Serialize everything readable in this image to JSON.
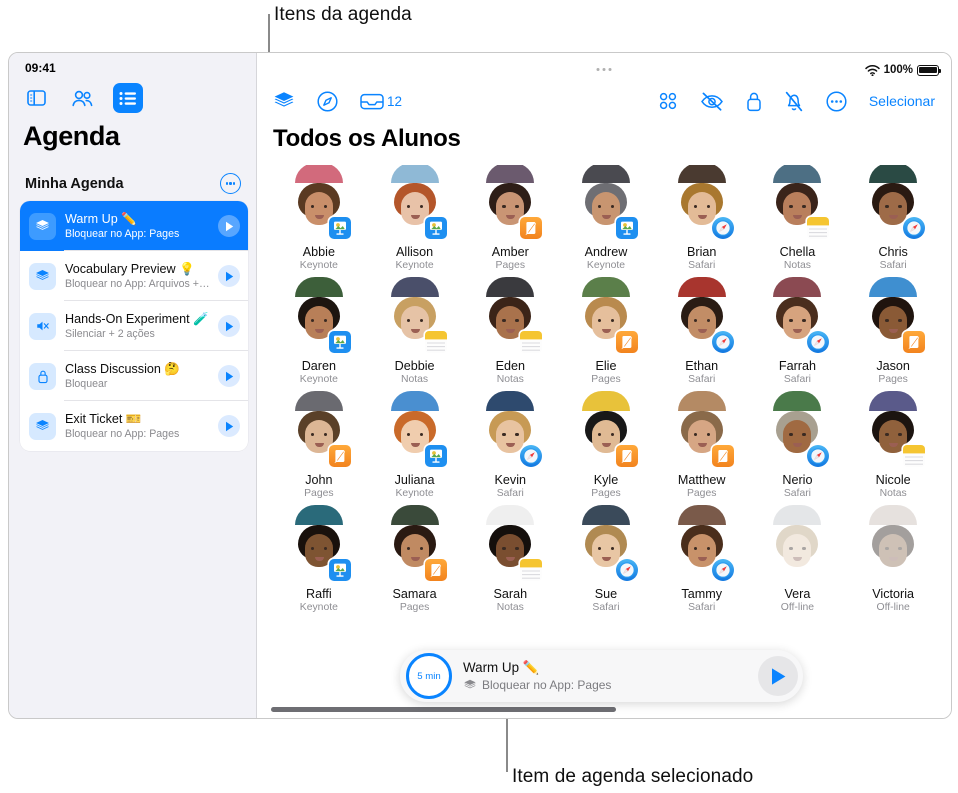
{
  "callouts": {
    "top": "Itens da agenda",
    "bottom": "Item de agenda selecionado"
  },
  "status_bar": {
    "time": "09:41",
    "battery_percent": "100%",
    "wifi_icon": "wifi-icon",
    "battery_icon": "battery-icon"
  },
  "sidebar": {
    "nav_icons": [
      {
        "name": "sidebar-toggle-icon",
        "active": false
      },
      {
        "name": "people-icon",
        "active": false
      },
      {
        "name": "list-icon",
        "active": true
      }
    ],
    "title": "Agenda",
    "section_label": "Minha Agenda",
    "more_button": "more-ellipsis-button",
    "items": [
      {
        "title": "Warm Up ✏️",
        "subtitle": "Bloquear no App: Pages",
        "icon": "layers-icon",
        "selected": true
      },
      {
        "title": "Vocabulary Preview 💡",
        "subtitle": "Bloquear no App: Arquivos +…",
        "icon": "layers-icon",
        "selected": false
      },
      {
        "title": "Hands-On Experiment 🧪",
        "subtitle": "Silenciar + 2 ações",
        "icon": "mute-icon",
        "selected": false
      },
      {
        "title": "Class Discussion 🤔",
        "subtitle": "Bloquear",
        "icon": "lock-icon",
        "selected": false
      },
      {
        "title": "Exit Ticket 🎫",
        "subtitle": "Bloquear no App: Pages",
        "icon": "layers-icon",
        "selected": false
      }
    ]
  },
  "toolbar": {
    "left": [
      {
        "name": "layers-icon",
        "label": ""
      },
      {
        "name": "compass-icon",
        "label": ""
      },
      {
        "name": "inbox-icon",
        "label": "12"
      }
    ],
    "right": [
      {
        "name": "grid-view-icon",
        "label": ""
      },
      {
        "name": "eye-slash-icon",
        "label": ""
      },
      {
        "name": "lock-icon",
        "label": ""
      },
      {
        "name": "bell-slash-icon",
        "label": ""
      },
      {
        "name": "more-ellipsis-icon",
        "label": ""
      }
    ],
    "select_label": "Selecionar"
  },
  "main": {
    "title": "Todos os Alunos",
    "students": [
      {
        "name": "Abbie",
        "app": "Keynote",
        "badge": "keynote",
        "offline": false,
        "hair": "#5a3a22",
        "skin": "#c98f6a",
        "body": "#d26a7c",
        "bg": "#a8bfa0"
      },
      {
        "name": "Allison",
        "app": "Keynote",
        "badge": "keynote",
        "offline": false,
        "hair": "#b4562a",
        "skin": "#e8c2a8",
        "body": "#8fb9d6",
        "bg": "#b6cbd8"
      },
      {
        "name": "Amber",
        "app": "Pages",
        "badge": "pages",
        "offline": false,
        "hair": "#2e1e17",
        "skin": "#c99574",
        "body": "#6b5a6e",
        "bg": "#6f7f8c"
      },
      {
        "name": "Andrew",
        "app": "Keynote",
        "badge": "keynote",
        "offline": false,
        "hair": "#6e6e73",
        "skin": "#c89570",
        "body": "#4a4a50",
        "bg": "#8d8d93"
      },
      {
        "name": "Brian",
        "app": "Safari",
        "badge": "safari",
        "offline": false,
        "hair": "#a9782f",
        "skin": "#e3bb97",
        "body": "#4a3a30",
        "bg": "#2f2721"
      },
      {
        "name": "Chella",
        "app": "Notas",
        "badge": "notas",
        "offline": false,
        "hair": "#3a241a",
        "skin": "#b97f5c",
        "body": "#4d6f84",
        "bg": "#b9c4b4"
      },
      {
        "name": "Chris",
        "app": "Safari",
        "badge": "safari",
        "offline": false,
        "hair": "#2a1a12",
        "skin": "#9e6b48",
        "body": "#2a4a44",
        "bg": "#2b5e56"
      },
      {
        "name": "Daren",
        "app": "Keynote",
        "badge": "keynote",
        "offline": false,
        "hair": "#1d1510",
        "skin": "#b87f58",
        "body": "#3d5f3a",
        "bg": "#8fa67f"
      },
      {
        "name": "Debbie",
        "app": "Notas",
        "badge": "notas",
        "offline": false,
        "hair": "#c8a062",
        "skin": "#e6c3a6",
        "body": "#4a4f6a",
        "bg": "#565b74"
      },
      {
        "name": "Eden",
        "app": "Notas",
        "badge": "notas",
        "offline": false,
        "hair": "#3b2418",
        "skin": "#a9724c",
        "body": "#3a3a3e",
        "bg": "#d8d2c8"
      },
      {
        "name": "Elie",
        "app": "Pages",
        "badge": "pages",
        "offline": false,
        "hair": "#b98a4e",
        "skin": "#e5bf9c",
        "body": "#5b7f4a",
        "bg": "#7a9b5e"
      },
      {
        "name": "Ethan",
        "app": "Safari",
        "badge": "safari",
        "offline": false,
        "hair": "#2a1c14",
        "skin": "#c28d66",
        "body": "#a8352e",
        "bg": "#3c4a3a"
      },
      {
        "name": "Farrah",
        "app": "Safari",
        "badge": "safari",
        "offline": false,
        "hair": "#4a2e1e",
        "skin": "#d6a37e",
        "body": "#8b4a52",
        "bg": "#cfd2d8"
      },
      {
        "name": "Jason",
        "app": "Pages",
        "badge": "pages",
        "offline": false,
        "hair": "#20140e",
        "skin": "#8a5a36",
        "body": "#3f8fd0",
        "bg": "#d8b98a"
      },
      {
        "name": "John",
        "app": "Pages",
        "badge": "pages",
        "offline": false,
        "hair": "#5a4028",
        "skin": "#dcb695",
        "body": "#6a6a70",
        "bg": "#c6b49a"
      },
      {
        "name": "Juliana",
        "app": "Keynote",
        "badge": "keynote",
        "offline": false,
        "hair": "#c96a2a",
        "skin": "#f0cdae",
        "body": "#4a8fd0",
        "bg": "#dfe3ea"
      },
      {
        "name": "Kevin",
        "app": "Safari",
        "badge": "safari",
        "offline": false,
        "hair": "#c79a55",
        "skin": "#e8c3a0",
        "body": "#2e4a6e",
        "bg": "#cfd8df"
      },
      {
        "name": "Kyle",
        "app": "Pages",
        "badge": "pages",
        "offline": false,
        "hair": "#181818",
        "skin": "#e0ba94",
        "body": "#e8c23a",
        "bg": "#dfe6ee"
      },
      {
        "name": "Matthew",
        "app": "Pages",
        "badge": "pages",
        "offline": false,
        "hair": "#8a6a4a",
        "skin": "#d6a684",
        "body": "#b48a64",
        "bg": "#b49a84"
      },
      {
        "name": "Nerio",
        "app": "Safari",
        "badge": "safari",
        "offline": false,
        "hair": "#a8a090",
        "skin": "#a06a42",
        "body": "#4a7a4a",
        "bg": "#5e8a52"
      },
      {
        "name": "Nicole",
        "app": "Notas",
        "badge": "notas",
        "offline": false,
        "hair": "#1c1410",
        "skin": "#90613c",
        "body": "#5a5a8a",
        "bg": "#6a6a8e"
      },
      {
        "name": "Raffi",
        "app": "Keynote",
        "badge": "keynote",
        "offline": false,
        "hair": "#19110c",
        "skin": "#7e5432",
        "body": "#2a6a7a",
        "bg": "#cbbfa8"
      },
      {
        "name": "Samara",
        "app": "Pages",
        "badge": "pages",
        "offline": false,
        "hair": "#2a1a12",
        "skin": "#c08a62",
        "body": "#3a4a3a",
        "bg": "#c8c08a"
      },
      {
        "name": "Sarah",
        "app": "Notas",
        "badge": "notas",
        "offline": false,
        "hair": "#140f0c",
        "skin": "#7a4e30",
        "body": "#efefef",
        "bg": "#e4e4e8"
      },
      {
        "name": "Sue",
        "app": "Safari",
        "badge": "safari",
        "offline": false,
        "hair": "#b08a52",
        "skin": "#e8c6a4",
        "body": "#3a4a5a",
        "bg": "#7e9a70"
      },
      {
        "name": "Tammy",
        "app": "Safari",
        "badge": "safari",
        "offline": false,
        "hair": "#4a2e1c",
        "skin": "#c8926a",
        "body": "#7a5a4a",
        "bg": "#8a7a6a"
      },
      {
        "name": "Vera",
        "app": "Off-line",
        "badge": "none",
        "offline": true,
        "hair": "#c2a068",
        "skin": "#ecc9a8",
        "body": "#c0c4cc",
        "bg": "#dfe2e8"
      },
      {
        "name": "Victoria",
        "app": "Off-line",
        "badge": "none",
        "offline": true,
        "hair": "#2a1c14",
        "skin": "#9a6a44",
        "body": "#c9b8ae",
        "bg": "#e2ded8"
      }
    ],
    "partial_row": [
      {
        "hair": "#5a3a24",
        "skin": "#e0bd9a",
        "body": "#e8c23a",
        "bg": "#cbb99a"
      },
      {
        "hair": "#1c1410",
        "skin": "#b07a50",
        "body": "#3fb0d8",
        "bg": "#d8c89a"
      }
    ]
  },
  "now_playing": {
    "timer": "5 min",
    "title": "Warm Up ✏️",
    "subtitle": "Bloquear no App: Pages",
    "sub_icon": "layers-icon",
    "play_button": "play-button"
  }
}
